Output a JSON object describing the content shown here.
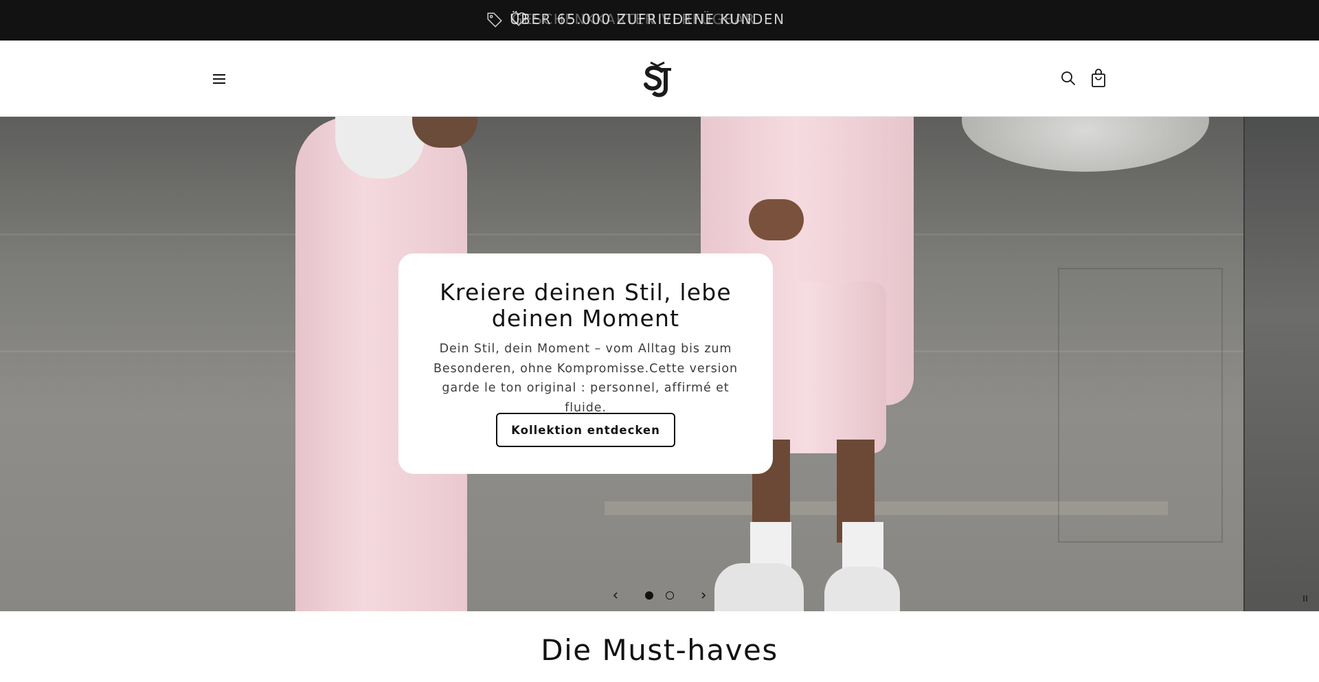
{
  "announcement": {
    "message_primary": "Über 65.000 zufriedene Kunden",
    "message_secondary": "Geschenkkarten verfügbar",
    "icons": [
      "tag-icon",
      "heart-icon"
    ]
  },
  "header": {
    "menu_icon": "hamburger-menu-icon",
    "logo_alt": "SJ",
    "search_icon": "search-icon",
    "cart_icon": "shopping-bag-icon"
  },
  "hero": {
    "title": "Kreiere deinen Stil, lebe deinen Moment",
    "text": "Dein Stil, dein Moment – vom Alltag bis zum Besonderen, ohne Kompromisse.Cette version garde le ton original : personnel, affirmé et fluide.",
    "button_label": "Kollektion entdecken",
    "slider": {
      "prev_icon": "chevron-left-icon",
      "next_icon": "chevron-right-icon",
      "slides": 2,
      "active_slide": 1,
      "pause_icon": "pause-icon"
    }
  },
  "section": {
    "title": "Die Must-haves"
  },
  "colors": {
    "announcement_bg": "#121212",
    "text": "#121212",
    "hoodie_pink": "#eecfd6",
    "card_bg": "#ffffff"
  }
}
